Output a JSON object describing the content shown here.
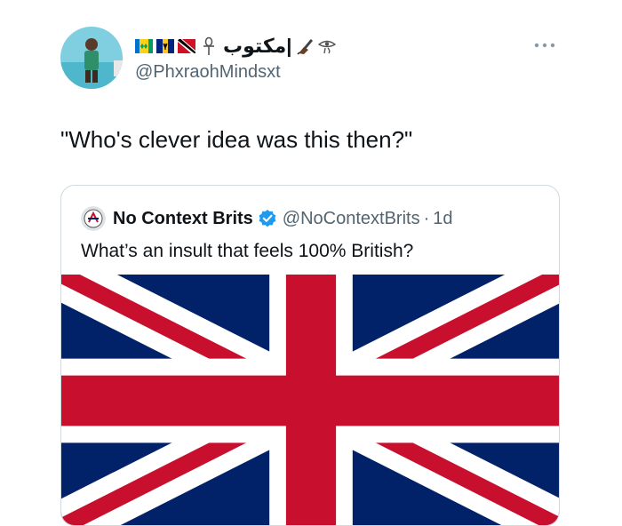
{
  "tweet": {
    "author_display_name": "مكتوب|",
    "author_handle": "@PhxraohMindsxt",
    "text": "\"Who's clever idea was this then?\"",
    "name_flags": [
      "saint-vincent-flag-icon",
      "barbados-flag-icon",
      "trinidad-flag-icon"
    ],
    "name_emojis": [
      "ankh-icon",
      "writing-hand-icon",
      "eye-of-horus-icon"
    ],
    "more_icon": "more-options-icon"
  },
  "quoted_tweet": {
    "author_display_name": "No Context Brits",
    "author_handle": "@NoContextBrits",
    "separator": "·",
    "time": "1d",
    "verified": true,
    "text": "What’s an insult that feels 100% British?",
    "media": "union-jack-flag-image"
  },
  "colors": {
    "text_primary": "#0f1419",
    "text_secondary": "#536471",
    "border": "#cfd9de",
    "verified_blue": "#1d9bf0",
    "flag_blue": "#012169",
    "flag_red": "#c8102e"
  }
}
